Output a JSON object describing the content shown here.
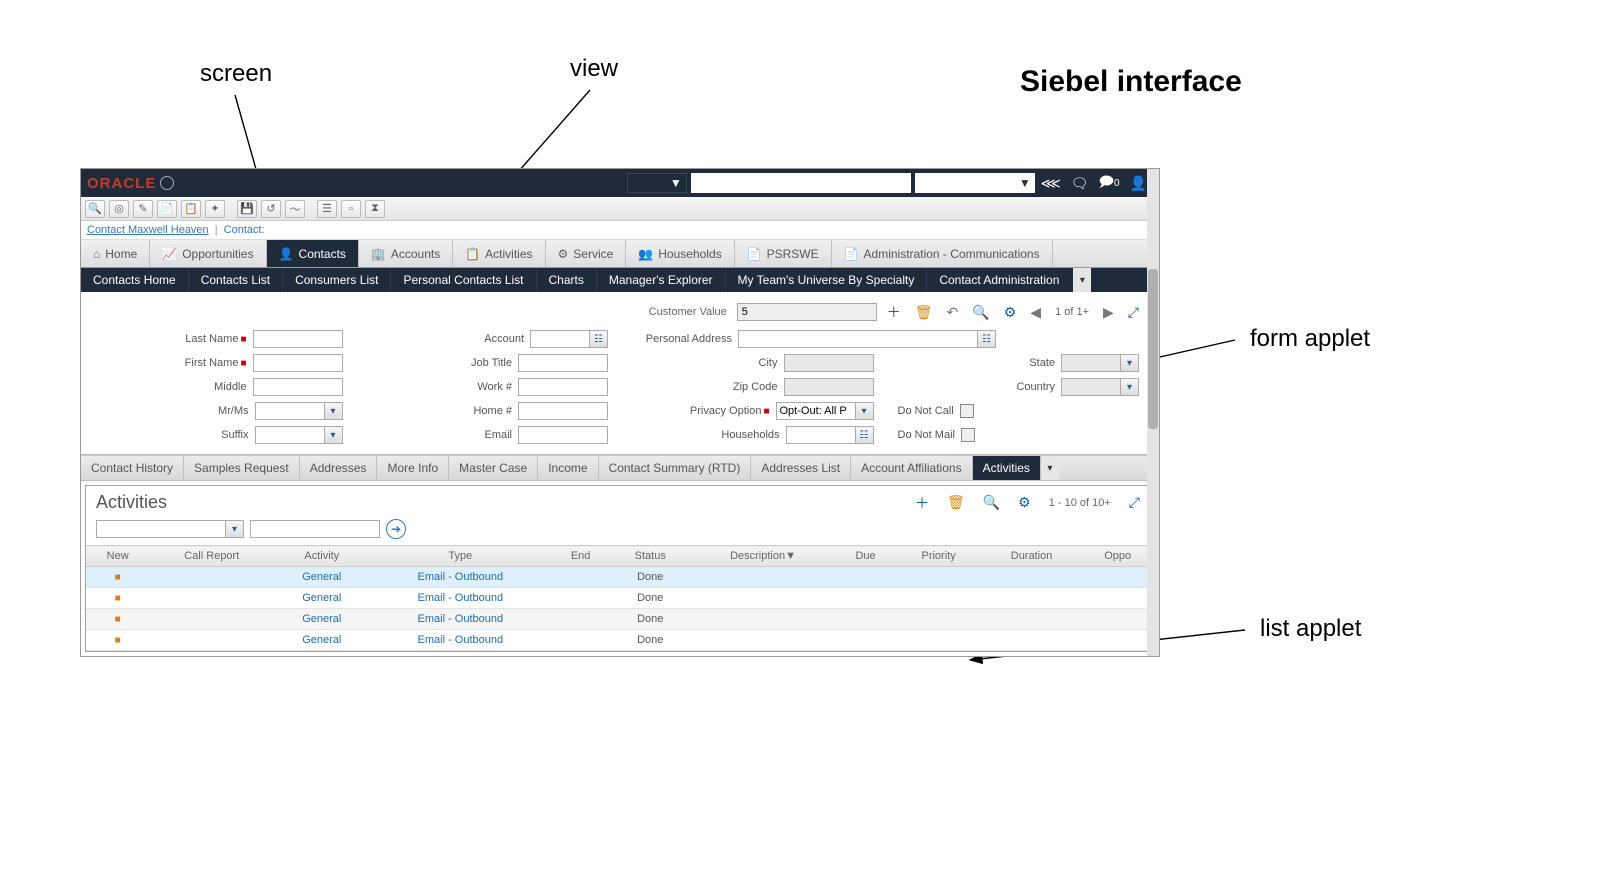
{
  "annotations": {
    "screen": "screen",
    "view": "view",
    "form_applet": "form applet",
    "list_applet": "list applet",
    "title": "Siebel interface"
  },
  "topbar": {
    "logo": "ORACLE",
    "notifications_label": "0"
  },
  "breadcrumb": {
    "part1": "Contact Maxwell Heaven",
    "sep": " | ",
    "part2": "Contact:"
  },
  "screenTabs": [
    {
      "icon": "home",
      "label": "Home"
    },
    {
      "icon": "chart",
      "label": "Opportunities"
    },
    {
      "icon": "person",
      "label": "Contacts",
      "active": true
    },
    {
      "icon": "building",
      "label": "Accounts"
    },
    {
      "icon": "clipboard",
      "label": "Activities"
    },
    {
      "icon": "gear",
      "label": "Service"
    },
    {
      "icon": "people",
      "label": "Households"
    },
    {
      "icon": "file",
      "label": "PSRSWE"
    },
    {
      "icon": "file",
      "label": "Administration - Communications"
    }
  ],
  "viewTabs": [
    "Contacts Home",
    "Contacts List",
    "Consumers List",
    "Personal Contacts List",
    "Charts",
    "Manager's Explorer",
    "My Team's Universe By Specialty",
    "Contact Administration"
  ],
  "formApplet": {
    "customerValue": {
      "label": "Customer Value",
      "value": "5"
    },
    "pager": "1 of 1+",
    "fields": {
      "lastName": {
        "label": "Last Name",
        "required": true,
        "value": ""
      },
      "firstName": {
        "label": "First Name",
        "required": true,
        "value": ""
      },
      "middle": {
        "label": "Middle",
        "value": ""
      },
      "mrms": {
        "label": "Mr/Ms",
        "value": ""
      },
      "suffix": {
        "label": "Suffix",
        "value": ""
      },
      "account": {
        "label": "Account",
        "value": ""
      },
      "jobTitle": {
        "label": "Job Title",
        "value": ""
      },
      "workNum": {
        "label": "Work #",
        "value": ""
      },
      "homeNum": {
        "label": "Home #",
        "value": ""
      },
      "email": {
        "label": "Email",
        "value": ""
      },
      "personalAddress": {
        "label": "Personal Address",
        "value": ""
      },
      "city": {
        "label": "City",
        "value": ""
      },
      "zip": {
        "label": "Zip Code",
        "value": ""
      },
      "privacy": {
        "label": "Privacy Option",
        "required": true,
        "value": "Opt-Out: All P"
      },
      "households": {
        "label": "Households",
        "value": ""
      },
      "state": {
        "label": "State",
        "value": ""
      },
      "country": {
        "label": "Country",
        "value": ""
      },
      "doNotCall": {
        "label": "Do Not Call"
      },
      "doNotMail": {
        "label": "Do Not Mail"
      }
    }
  },
  "childTabs": [
    "Contact History",
    "Samples Request",
    "Addresses",
    "More Info",
    "Master Case",
    "Income",
    "Contact Summary (RTD)",
    "Addresses List",
    "Account Affiliations",
    "Activities"
  ],
  "childActive": "Activities",
  "listApplet": {
    "title": "Activities",
    "pager": "1 - 10 of 10+",
    "columns": [
      "New",
      "Call Report",
      "Activity",
      "Type",
      "End",
      "Status",
      "Description▼",
      "Due",
      "Priority",
      "Duration",
      "Oppo"
    ],
    "rows": [
      {
        "new": "■",
        "activity": "General",
        "type": "Email - Outbound",
        "status": "Done",
        "sel": true
      },
      {
        "new": "■",
        "activity": "General",
        "type": "Email - Outbound",
        "status": "Done"
      },
      {
        "new": "■",
        "activity": "General",
        "type": "Email - Outbound",
        "status": "Done",
        "alt": true
      },
      {
        "new": "■",
        "activity": "General",
        "type": "Email - Outbound",
        "status": "Done"
      }
    ]
  }
}
